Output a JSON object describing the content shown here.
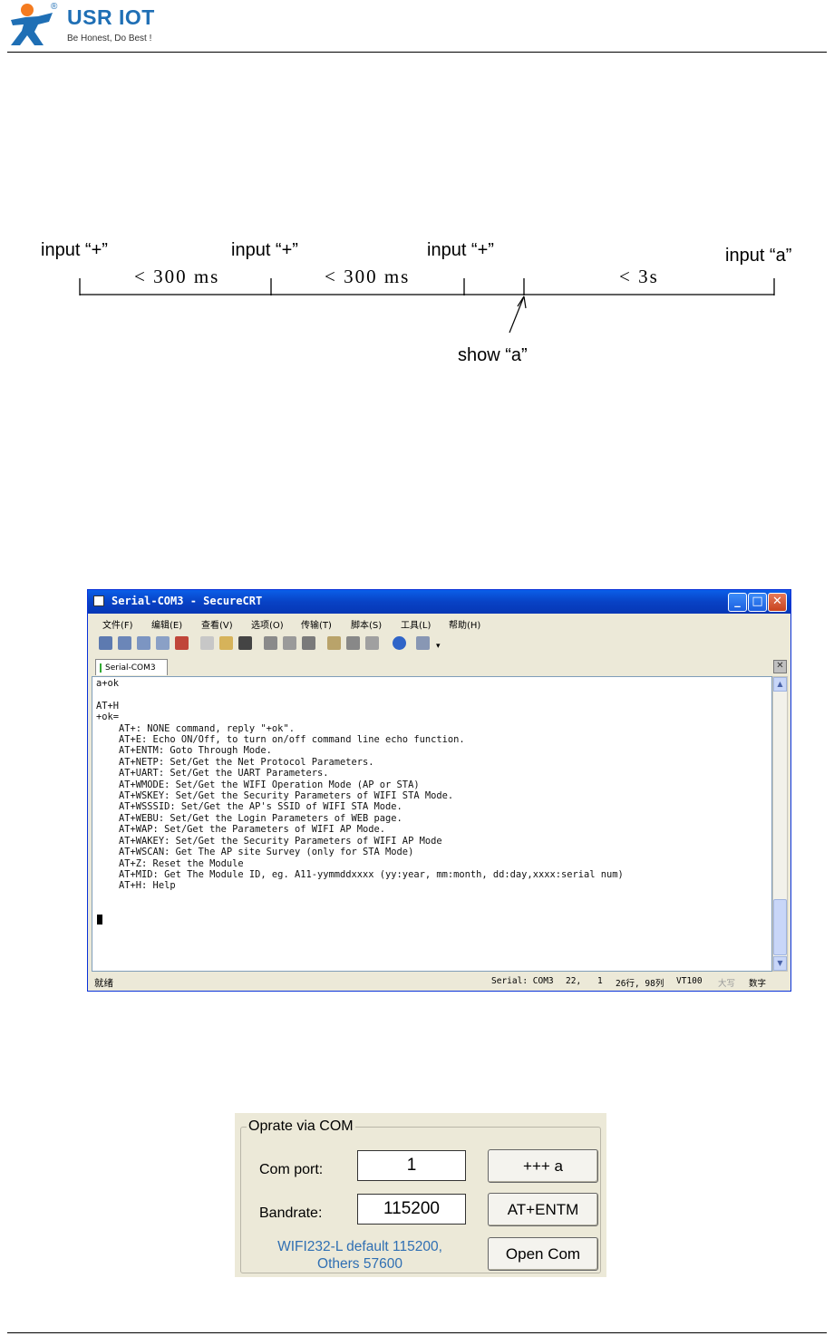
{
  "header": {
    "brand": "USR IOT",
    "registered_mark": "®",
    "slogan": "Be Honest, Do Best !",
    "brand_color": "#1f6fb5"
  },
  "timing_diagram": {
    "inputs": [
      "input “+”",
      "input “+”",
      "input “+”",
      "input “a”"
    ],
    "intervals": [
      "< 300 ms",
      "< 300 ms",
      "< 3s"
    ],
    "show_label": "show “a”"
  },
  "securecrt": {
    "title": "Serial-COM3 - SecureCRT",
    "menu": [
      "文件(F)",
      "编辑(E)",
      "查看(V)",
      "选项(O)",
      "传输(T)",
      "脚本(S)",
      "工具(L)",
      "帮助(H)"
    ],
    "toolbar_icons": [
      "connect-icon",
      "quick-connect-icon",
      "connect-tab-icon",
      "reconnect-icon",
      "disconnect-icon",
      "copy-icon",
      "paste-icon",
      "find-icon",
      "print-icon",
      "print-selection-icon",
      "printer-setup-icon",
      "session-options-icon",
      "global-options-icon",
      "keymap-icon",
      "help-icon",
      "sftp-icon"
    ],
    "tab": "Serial-COM3",
    "terminal_lines": [
      "a+ok",
      "",
      "AT+H",
      "+ok=",
      "    AT+: NONE command, reply \"+ok\".",
      "    AT+E: Echo ON/Off, to turn on/off command line echo function.",
      "    AT+ENTM: Goto Through Mode.",
      "    AT+NETP: Set/Get the Net Protocol Parameters.",
      "    AT+UART: Set/Get the UART Parameters.",
      "    AT+WMODE: Set/Get the WIFI Operation Mode (AP or STA)",
      "    AT+WSKEY: Set/Get the Security Parameters of WIFI STA Mode.",
      "    AT+WSSSID: Set/Get the AP's SSID of WIFI STA Mode.",
      "    AT+WEBU: Set/Get the Login Parameters of WEB page.",
      "    AT+WAP: Set/Get the Parameters of WIFI AP Mode.",
      "    AT+WAKEY: Set/Get the Security Parameters of WIFI AP Mode",
      "    AT+WSCAN: Get The AP site Survey (only for STA Mode)",
      "    AT+Z: Reset the Module",
      "    AT+MID: Get The Module ID, eg. A11-yymmddxxxx (yy:year, mm:month, dd:day,xxxx:serial num)",
      "    AT+H: Help"
    ],
    "status": {
      "ready": "就绪",
      "port": "Serial: COM3",
      "cursor_row": "22,",
      "cursor_col": "1",
      "size": "26行, 98列",
      "emulation": "VT100",
      "caps": "大写",
      "num": "数字"
    }
  },
  "com_panel": {
    "legend": "Oprate via COM",
    "com_port_label": "Com port:",
    "com_port_value": "1",
    "bandrate_label": "Bandrate:",
    "bandrate_value": "115200",
    "note_line1": "WIFI232-L default 115200,",
    "note_line2": "Others 57600",
    "btn_plus": "+++ a",
    "btn_entm": "AT+ENTM",
    "btn_open": "Open Com"
  }
}
